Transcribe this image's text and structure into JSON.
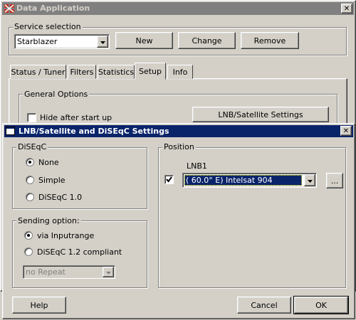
{
  "main_window": {
    "title": "Data Application",
    "close_glyph": "✕",
    "service_group_label": "Service selection",
    "service_value": "Starblazer",
    "buttons": {
      "new": "New",
      "change": "Change",
      "remove": "Remove"
    },
    "tabs": [
      {
        "label": "Status / Tuner"
      },
      {
        "label": "Filters"
      },
      {
        "label": "Statistics"
      },
      {
        "label": "Setup"
      },
      {
        "label": "Info"
      }
    ],
    "active_tab": "Setup",
    "general_options_label": "General Options",
    "hide_after_start_label": "Hide after start up",
    "lnb_settings_button": "LNB/Satellite Settings"
  },
  "dialog": {
    "title": "LNB/Satellite and DiSEqC Settings",
    "close_glyph": "✕",
    "diseqc": {
      "label": "DiSEqC",
      "options": [
        "None",
        "Simple",
        "DiSEqC 1.0"
      ],
      "selected": "None"
    },
    "sending": {
      "label": "Sending option:",
      "options": [
        "via Inputrange",
        "DiSEqC 1.2 compliant"
      ],
      "selected": "via Inputrange",
      "repeat_value": "no Repeat"
    },
    "position": {
      "label": "Position",
      "lnb_label": "LNB1",
      "lnb_checked": true,
      "satellite_value": "( 60.0° E) Intelsat 904",
      "browse_label": "..."
    },
    "buttons": {
      "help": "Help",
      "cancel": "Cancel",
      "ok": "OK"
    }
  },
  "colors": {
    "face": "#d4d0c8",
    "active_title": "#0a246a",
    "inactive_title": "#808080",
    "selection": "#0a246a"
  }
}
